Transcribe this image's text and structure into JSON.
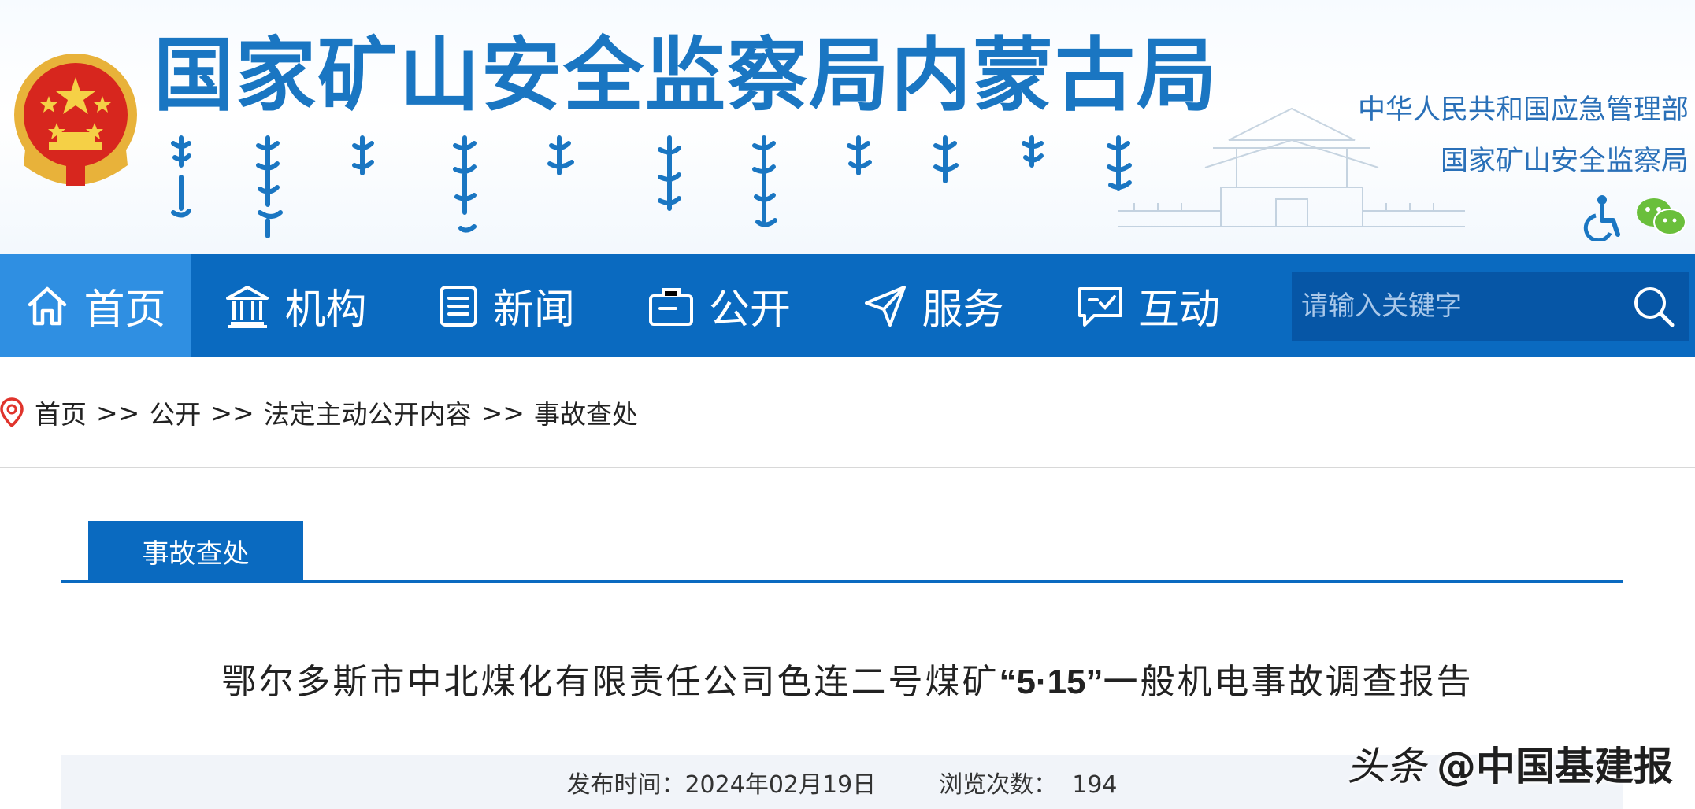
{
  "header": {
    "site_title": "国家矿山安全监察局内蒙古局",
    "org_links": [
      "中华人民共和国应急管理部",
      "国家矿山安全监察局"
    ],
    "icons": [
      "accessibility-icon",
      "wechat-icon"
    ],
    "colors": {
      "title": "#1a76c2",
      "nav": "#0a6ac0",
      "nav_active": "#2f8fe2",
      "search_bg": "#0656a6"
    }
  },
  "nav": {
    "items": [
      {
        "label": "首页",
        "icon": "home-icon",
        "active": true
      },
      {
        "label": "机构",
        "icon": "institution-icon"
      },
      {
        "label": "新闻",
        "icon": "news-icon"
      },
      {
        "label": "公开",
        "icon": "briefcase-icon"
      },
      {
        "label": "服务",
        "icon": "send-icon"
      },
      {
        "label": "互动",
        "icon": "chat-icon"
      }
    ],
    "search": {
      "placeholder": "请输入关键字",
      "icon": "search-icon"
    }
  },
  "breadcrumb": {
    "items": [
      "首页",
      "公开",
      "法定主动公开内容",
      "事故查处"
    ],
    "separator": ">>"
  },
  "content": {
    "tab_label": "事故查处",
    "title_part1": "鄂尔多斯市中北煤化有限责任公司色连二号煤矿",
    "title_part2": "“5·15”",
    "title_part3": "一般机电事故调查报告",
    "publish": "发布时间：2024年02月19日",
    "views": "浏览次数：  194"
  },
  "watermark": {
    "platform": "头条",
    "account": "@中国基建报"
  }
}
